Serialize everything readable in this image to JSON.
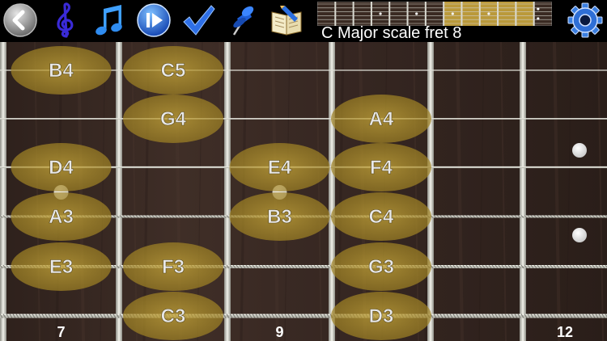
{
  "title": "C Major scale fret 8",
  "toolbar": {
    "buttons": [
      {
        "name": "back-button",
        "icon": "back-arrow-icon"
      },
      {
        "name": "clef-button",
        "icon": "treble-clef-icon"
      },
      {
        "name": "notes-button",
        "icon": "music-note-icon"
      },
      {
        "name": "play-button",
        "icon": "play-next-icon"
      },
      {
        "name": "check-button",
        "icon": "checkmark-icon"
      },
      {
        "name": "pin-button",
        "icon": "push-pin-icon"
      },
      {
        "name": "book-button",
        "icon": "open-book-icon"
      },
      {
        "name": "settings-button",
        "icon": "gear-icon"
      }
    ]
  },
  "colors": {
    "accent_blue": "#1b4fd0",
    "note_highlight": "#b99a2e",
    "fret_wire": "#d8d8d0",
    "wood": "#3b2a24",
    "mini_highlight": "#c9a53d"
  },
  "fretboard": {
    "first_fret": 7,
    "fret_count": 6,
    "fret_markers": [
      7,
      9,
      12
    ],
    "inlay_frets": [
      7,
      9,
      12
    ],
    "strings": 6,
    "notes": [
      {
        "label": "B4",
        "string": 1,
        "fret": 7
      },
      {
        "label": "C5",
        "string": 1,
        "fret": 8
      },
      {
        "label": "G4",
        "string": 2,
        "fret": 8
      },
      {
        "label": "A4",
        "string": 2,
        "fret": 10
      },
      {
        "label": "D4",
        "string": 3,
        "fret": 7
      },
      {
        "label": "E4",
        "string": 3,
        "fret": 9
      },
      {
        "label": "F4",
        "string": 3,
        "fret": 10
      },
      {
        "label": "A3",
        "string": 4,
        "fret": 7
      },
      {
        "label": "B3",
        "string": 4,
        "fret": 9
      },
      {
        "label": "C4",
        "string": 4,
        "fret": 10
      },
      {
        "label": "E3",
        "string": 5,
        "fret": 7
      },
      {
        "label": "F3",
        "string": 5,
        "fret": 8
      },
      {
        "label": "G3",
        "string": 5,
        "fret": 10
      },
      {
        "label": "C3",
        "string": 6,
        "fret": 8
      },
      {
        "label": "D3",
        "string": 6,
        "fret": 10
      }
    ]
  },
  "mini_fretboard": {
    "frets": 12,
    "highlight_start_fret": 7,
    "highlight_end_fret": 11
  }
}
